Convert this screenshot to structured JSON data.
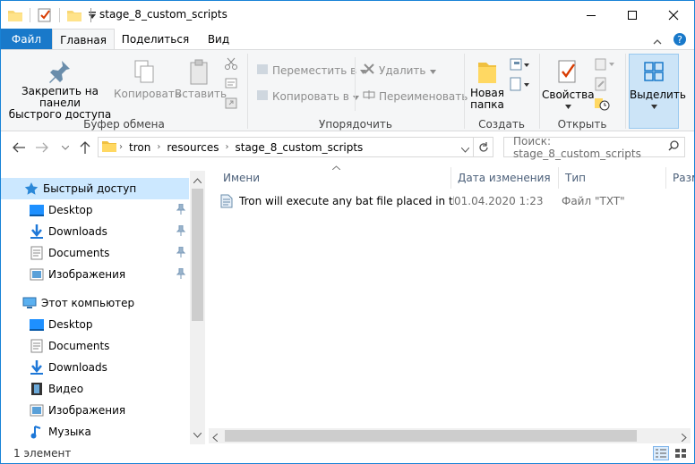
{
  "window": {
    "title": "stage_8_custom_scripts"
  },
  "ribbon_tabs": {
    "file": "Файл",
    "home": "Главная",
    "share": "Поделиться",
    "view": "Вид"
  },
  "ribbon": {
    "pin_label_1": "Закрепить на панели",
    "pin_label_2": "быстрого доступа",
    "copy": "Копировать",
    "paste": "Вставить",
    "clipboard_group": "Буфер обмена",
    "move_to": "Переместить в",
    "copy_to": "Копировать в",
    "delete": "Удалить",
    "rename": "Переименовать",
    "organize_group": "Упорядочить",
    "new_folder_1": "Новая",
    "new_folder_2": "папка",
    "create_group": "Создать",
    "properties": "Свойства",
    "open_group": "Открыть",
    "select": "Выделить"
  },
  "address": {
    "crumbs": [
      "tron",
      "resources",
      "stage_8_custom_scripts"
    ],
    "search_placeholder": "Поиск: stage_8_custom_scripts"
  },
  "nav": {
    "quick_access": "Быстрый доступ",
    "qa_items": [
      "Desktop",
      "Downloads",
      "Documents",
      "Изображения"
    ],
    "this_pc": "Этот компьютер",
    "pc_items": [
      "Desktop",
      "Documents",
      "Downloads",
      "Видео",
      "Изображения",
      "Музыка"
    ]
  },
  "columns": {
    "name": "Имени",
    "date": "Дата изменения",
    "type": "Тип",
    "size": "Разм"
  },
  "files": [
    {
      "name": "Tron will execute any bat file placed in thi...",
      "date": "01.04.2020 1:23",
      "type": "Файл \"TXT\""
    }
  ],
  "status": {
    "count": "1 элемент"
  },
  "colors": {
    "accent": "#1979ca",
    "selection": "#cce8ff",
    "border": "#1883d7"
  }
}
